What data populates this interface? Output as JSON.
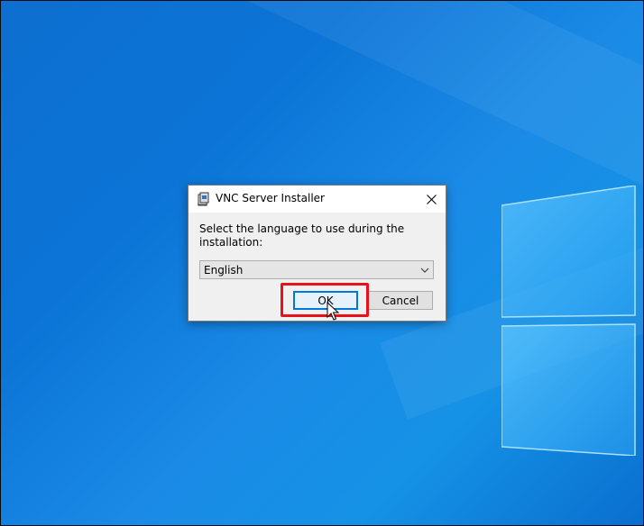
{
  "dialog": {
    "title": "VNC Server Installer",
    "prompt": "Select the language to use during the installation:",
    "language_select": {
      "value": "English"
    },
    "ok_label": "OK",
    "cancel_label": "Cancel"
  },
  "icons": {
    "title_icon": "installer-icon",
    "close": "close-icon",
    "dropdown": "chevron-down-icon",
    "cursor": "mouse-cursor-icon"
  },
  "colors": {
    "desktop_blue": "#0b74d6",
    "dialog_bg": "#f0f0f0",
    "ok_border": "#0078d7",
    "highlight": "#e8101a"
  }
}
